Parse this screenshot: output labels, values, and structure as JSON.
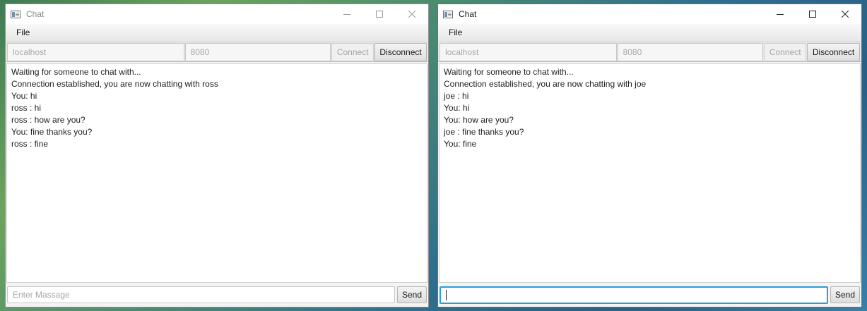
{
  "left_window": {
    "title": "Chat",
    "menu": [
      "File"
    ],
    "host": "localhost",
    "port": "8080",
    "connect_label": "Connect",
    "disconnect_label": "Disconnect",
    "messages": [
      "Waiting for someone to chat with...",
      "Connection established, you are now chatting with ross",
      "You: hi",
      "ross : hi",
      "ross : how are you?",
      "You: fine thanks you?",
      "ross : fine"
    ],
    "input_placeholder": "Enter Massage",
    "send_label": "Send"
  },
  "right_window": {
    "title": "Chat",
    "menu": [
      "File"
    ],
    "host": "localhost",
    "port": "8080",
    "connect_label": "Connect",
    "disconnect_label": "Disconnect",
    "messages": [
      "Waiting for someone to chat with...",
      "Connection established, you are now chatting with joe",
      "joe : hi",
      "You: hi",
      "You: how are you?",
      "joe : fine thanks you?",
      "You: fine"
    ],
    "input_value": "",
    "send_label": "Send"
  },
  "colors": {
    "focus_accent": "#2a9fd6",
    "desktop": "#2f6f8e"
  },
  "icons": {
    "app": "app-window-icon",
    "minimize": "minimize-icon",
    "maximize": "maximize-icon",
    "close": "close-icon"
  }
}
